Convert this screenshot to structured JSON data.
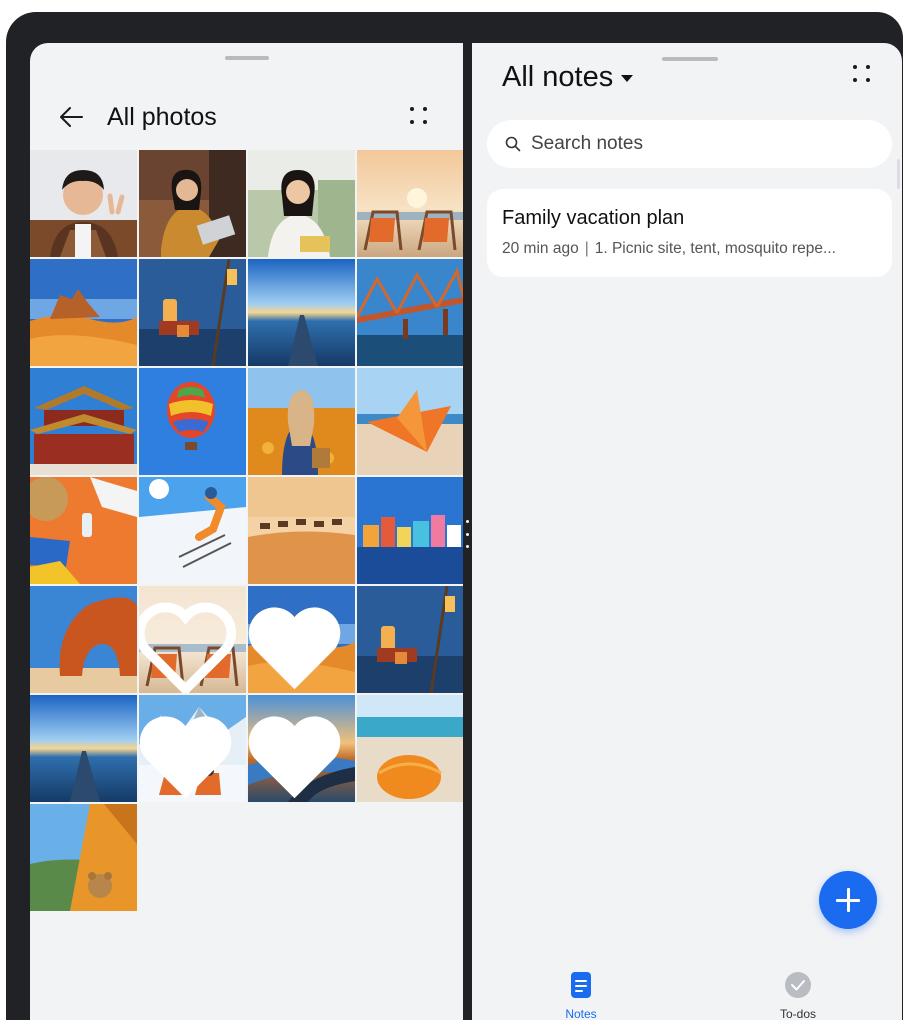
{
  "left_pane": {
    "title": "All photos",
    "back_icon": "arrow-left-icon",
    "menu_icon": "more-options-icon",
    "photos": [
      {
        "name": "photo-man-portrait",
        "favorite": false
      },
      {
        "name": "photo-woman-laptop",
        "favorite": false
      },
      {
        "name": "photo-woman-sofa",
        "favorite": false
      },
      {
        "name": "photo-beach-chairs",
        "favorite": false
      },
      {
        "name": "photo-desert-rocks",
        "favorite": false
      },
      {
        "name": "photo-lantern-night",
        "favorite": false
      },
      {
        "name": "photo-sunrise-road",
        "favorite": false
      },
      {
        "name": "photo-bridge",
        "favorite": false
      },
      {
        "name": "photo-palace",
        "favorite": false
      },
      {
        "name": "photo-hot-air-balloon",
        "favorite": false
      },
      {
        "name": "photo-woman-flowers",
        "favorite": false
      },
      {
        "name": "photo-paper-boat",
        "favorite": false
      },
      {
        "name": "photo-beach-items",
        "favorite": false
      },
      {
        "name": "photo-skier",
        "favorite": false
      },
      {
        "name": "photo-camel-caravan",
        "favorite": false
      },
      {
        "name": "photo-colorful-houses",
        "favorite": false
      },
      {
        "name": "photo-rock-arch",
        "favorite": false
      },
      {
        "name": "photo-beach-chairs-2",
        "favorite": true
      },
      {
        "name": "photo-desert-rocks-2",
        "favorite": true
      },
      {
        "name": "photo-lantern-night-2",
        "favorite": false
      },
      {
        "name": "photo-sunrise-road-2",
        "favorite": false
      },
      {
        "name": "photo-snow-mountain-chairs",
        "favorite": true
      },
      {
        "name": "photo-lake-road",
        "favorite": true
      },
      {
        "name": "photo-orange-umbrella",
        "favorite": false
      },
      {
        "name": "photo-tent-teddy",
        "favorite": false
      }
    ]
  },
  "right_pane": {
    "title": "All notes",
    "menu_icon": "more-options-icon",
    "search": {
      "placeholder": "Search notes",
      "icon": "search-icon"
    },
    "notes": [
      {
        "title": "Family vacation plan",
        "time": "20 min ago",
        "preview": "1. Picnic site, tent, mosquito repe..."
      }
    ],
    "fab_icon": "plus-icon",
    "tabs": [
      {
        "label": "Notes",
        "icon": "notes-icon",
        "active": true
      },
      {
        "label": "To-dos",
        "icon": "check-circle-icon",
        "active": false
      }
    ]
  },
  "colors": {
    "accent": "#1a6bf0",
    "pane_bg": "#f1f3f5",
    "bezel": "#202226"
  }
}
